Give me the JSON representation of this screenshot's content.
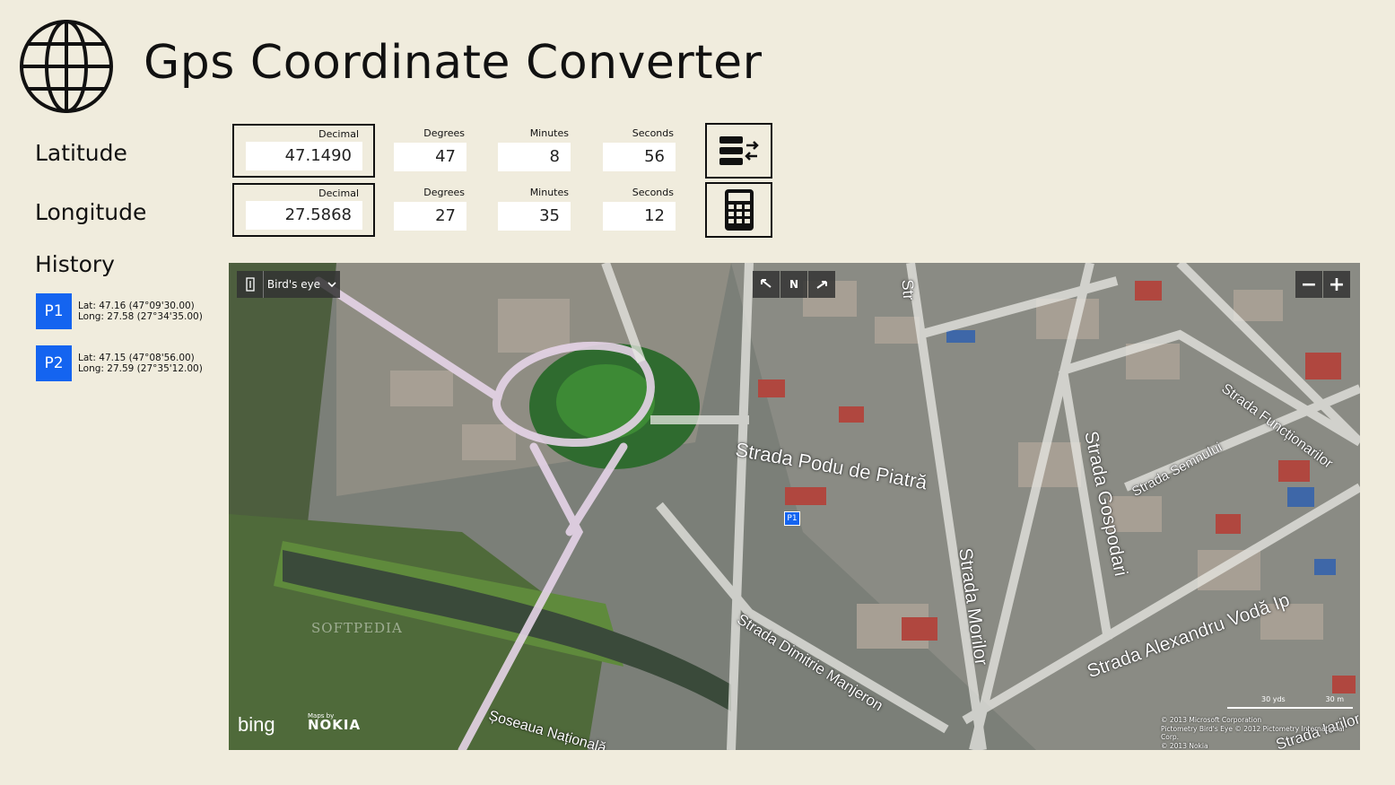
{
  "app": {
    "title": "Gps Coordinate Converter",
    "icon": "globe-icon"
  },
  "labels": {
    "latitude": "Latitude",
    "longitude": "Longitude",
    "history": "History"
  },
  "captions": {
    "decimal": "Decimal",
    "degrees": "Degrees",
    "minutes": "Minutes",
    "seconds": "Seconds"
  },
  "latitude": {
    "decimal": "47.1490",
    "degrees": "47",
    "minutes": "8",
    "seconds": "56"
  },
  "longitude": {
    "decimal": "27.5868",
    "degrees": "27",
    "minutes": "35",
    "seconds": "12"
  },
  "buttons": {
    "convert_icon": "convert-list-icon",
    "calculator_icon": "calculator-icon"
  },
  "history": [
    {
      "badge": "P1",
      "lat": "Lat: 47.16 (47°09'30.00)",
      "long": "Long: 27.58 (27°34'35.00)"
    },
    {
      "badge": "P2",
      "lat": "Lat: 47.15 (47°08'56.00)",
      "long": "Long: 27.59 (27°35'12.00)"
    }
  ],
  "map": {
    "style_label": "Bird's eye",
    "nav": {
      "rotate_left": "⇱",
      "north": "N",
      "rotate_right": "⇲"
    },
    "zoom": {
      "out": "−",
      "in": "+"
    },
    "pin_label": "P1",
    "streets": [
      "Strada Podu de Piatră",
      "Strada Morilor",
      "Strada Gospodari",
      "Strada Semnului",
      "Strada Funcționarilor",
      "Strada Dimitrie Manjeron",
      "Strada Alexandru Vodă Ip",
      "Șoseaua Națională",
      "Strada Iarilor",
      "Str"
    ],
    "watermark": "SOFTPEDIA",
    "bing": "bing",
    "maps_by": "Maps by",
    "nokia": "NOKIA",
    "scale_yds": "30 yds",
    "scale_m": "30 m",
    "copyright": [
      "© 2013 Microsoft Corporation",
      "Pictometry Bird's Eye © 2012 Pictometry International Corp.",
      "© 2013 Nokia"
    ]
  }
}
